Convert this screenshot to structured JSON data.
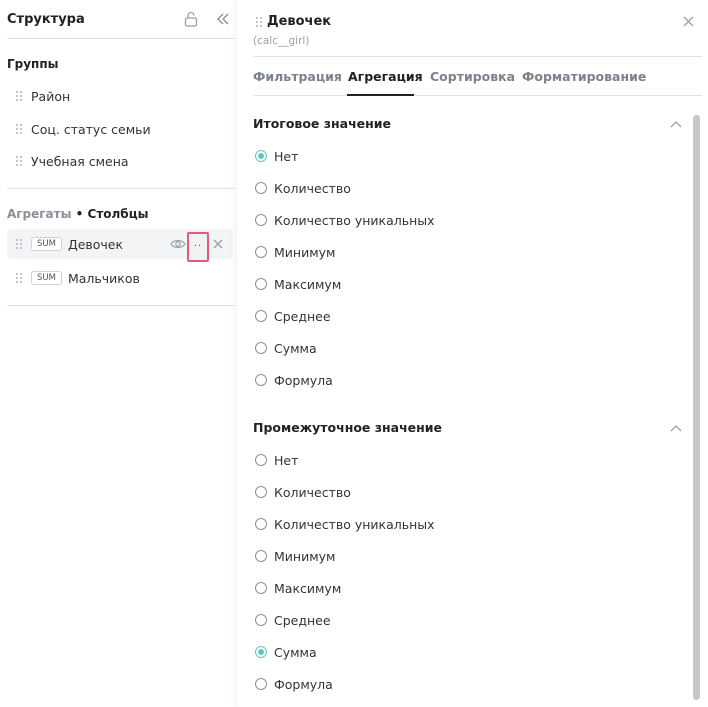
{
  "structure": {
    "title": "Структура",
    "groups_title": "Группы",
    "groups": [
      {
        "label": "Район"
      },
      {
        "label": "Соц. статус семьи"
      },
      {
        "label": "Учебная смена"
      }
    ],
    "aggregates_title": "Агрегаты",
    "aggregates_separator": "•",
    "columns_title": "Столбцы",
    "aggregates": [
      {
        "badge": "SUM",
        "label": "Девочек",
        "active": true
      },
      {
        "badge": "SUM",
        "label": "Мальчиков",
        "active": false
      }
    ],
    "more_label": "··"
  },
  "detail": {
    "title": "Девочек",
    "subtitle": "(calc__girl)",
    "tabs": [
      {
        "label": "Фильтрация"
      },
      {
        "label": "Агрегация",
        "active": true
      },
      {
        "label": "Сортировка"
      },
      {
        "label": "Форматирование"
      }
    ],
    "total": {
      "title": "Итоговое значение",
      "options": [
        "Нет",
        "Количество",
        "Количество уникальных",
        "Минимум",
        "Максимум",
        "Среднее",
        "Сумма",
        "Формула"
      ],
      "selected": "Нет"
    },
    "intermediate": {
      "title": "Промежуточное значение",
      "options": [
        "Нет",
        "Количество",
        "Количество уникальных",
        "Минимум",
        "Максимум",
        "Среднее",
        "Сумма",
        "Формула"
      ],
      "selected": "Сумма"
    }
  },
  "colors": {
    "accent": "#5fc8bd",
    "highlight_border": "#e25b7c"
  }
}
